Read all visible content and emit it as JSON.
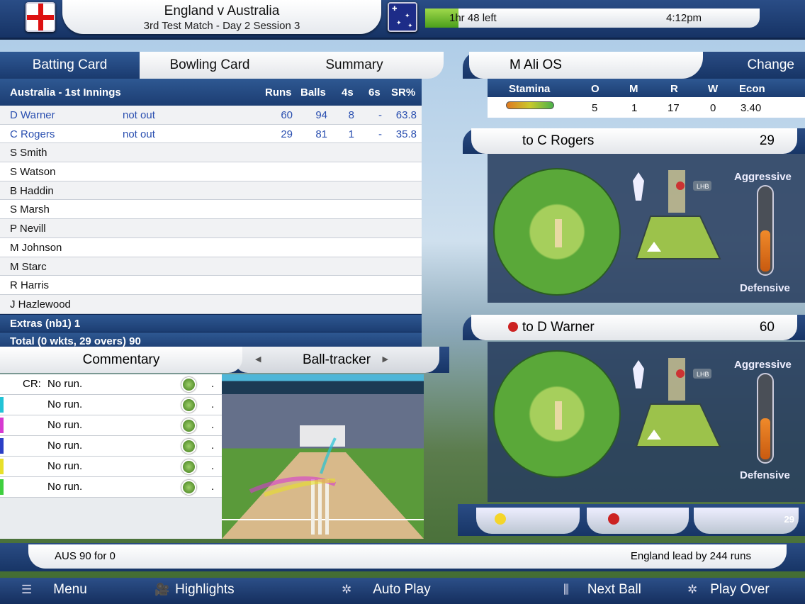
{
  "header": {
    "title": "England v Australia",
    "subtitle": "3rd Test Match - Day 2 Session 3",
    "time_left": "1hr 48 left",
    "clock": "4:12pm",
    "time_fill_pct": 10
  },
  "tabs": {
    "batting": "Batting Card",
    "bowling": "Bowling Card",
    "summary": "Summary"
  },
  "batting": {
    "innings": "Australia - 1st Innings",
    "columns": [
      "Runs",
      "Balls",
      "4s",
      "6s",
      "SR%"
    ],
    "rows": [
      {
        "name": "D Warner",
        "status": "not out",
        "runs": "60",
        "balls": "94",
        "fours": "8",
        "sixes": "-",
        "sr": "63.8"
      },
      {
        "name": "C Rogers",
        "status": "not out",
        "runs": "29",
        "balls": "81",
        "fours": "1",
        "sixes": "-",
        "sr": "35.8"
      },
      {
        "name": "S Smith"
      },
      {
        "name": "S Watson"
      },
      {
        "name": "B Haddin"
      },
      {
        "name": "S Marsh"
      },
      {
        "name": "P Nevill"
      },
      {
        "name": "M Johnson"
      },
      {
        "name": "M Starc"
      },
      {
        "name": "R Harris"
      },
      {
        "name": "J Hazlewood"
      }
    ],
    "extras": "Extras (nb1) 1",
    "total": "Total (0 wkts, 29 overs) 90"
  },
  "commentary": {
    "tab": "Commentary",
    "tracker_tab": "Ball-tracker",
    "rows": [
      {
        "who": "CR:",
        "text": "No run.",
        "dot": ".",
        "color": "#ffffff"
      },
      {
        "who": "",
        "text": "No run.",
        "dot": ".",
        "color": "#22c3d6"
      },
      {
        "who": "",
        "text": "No run.",
        "dot": ".",
        "color": "#d63ad0"
      },
      {
        "who": "",
        "text": "No run.",
        "dot": ".",
        "color": "#2b3fc6"
      },
      {
        "who": "",
        "text": "No run.",
        "dot": ".",
        "color": "#e8e02a"
      },
      {
        "who": "",
        "text": "No run.",
        "dot": ".",
        "color": "#3fcf3f"
      }
    ]
  },
  "bowler": {
    "name": "M Ali OS",
    "change": "Change",
    "columns": [
      "Stamina",
      "O",
      "M",
      "R",
      "W",
      "Econ"
    ],
    "values": {
      "o": "5",
      "m": "1",
      "r": "17",
      "w": "0",
      "econ": "3.40"
    }
  },
  "batsman1": {
    "label": "to C Rogers",
    "runs": "29",
    "hand": "LHB",
    "top": "Aggressive",
    "bottom": "Defensive"
  },
  "batsman2": {
    "label": "to D Warner",
    "runs": "60",
    "hand": "LHB",
    "top": "Aggressive",
    "bottom": "Defensive"
  },
  "controls": {
    "badge": "29"
  },
  "status": {
    "left": "AUS  90 for 0",
    "right": "England lead by 244 runs"
  },
  "bottom": {
    "menu": "Menu",
    "highlights": "Highlights",
    "autoplay": "Auto Play",
    "nextball": "Next Ball",
    "playover": "Play Over"
  },
  "icons": [
    "menu-icon",
    "camera-icon",
    "batsman-icon",
    "stumps-icon",
    "fielders-icon"
  ]
}
